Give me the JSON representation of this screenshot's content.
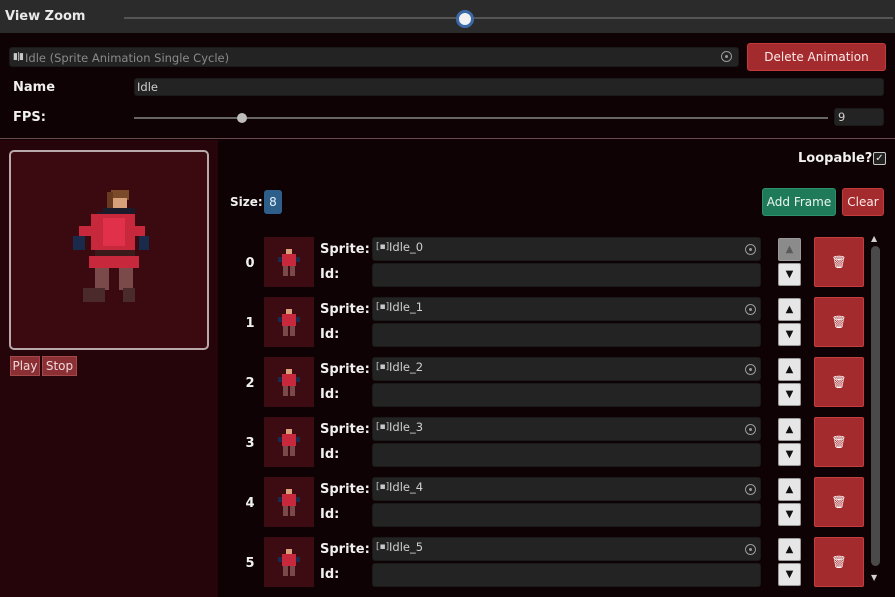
{
  "zoom": {
    "label": "View Zoom",
    "level": 0.43
  },
  "animation": {
    "asset_label": "Idle (Sprite Animation Single Cycle)",
    "delete_label": "Delete Animation",
    "name_label": "Name",
    "name_value": "Idle",
    "fps_label": "FPS:",
    "fps_value": "9",
    "fps_level": 0.15
  },
  "preview": {
    "play_label": "Play",
    "stop_label": "Stop"
  },
  "frames_panel": {
    "loopable_label": "Loopable?",
    "loopable_checked": "✓",
    "size_label": "Size:",
    "size_value": "8",
    "add_frame_label": "Add Frame",
    "clear_label": "Clear",
    "sprite_label": "Sprite:",
    "id_label": "Id:",
    "frames": [
      {
        "index": "0",
        "sprite": "Idle_0",
        "id": ""
      },
      {
        "index": "1",
        "sprite": "Idle_1",
        "id": ""
      },
      {
        "index": "2",
        "sprite": "Idle_2",
        "id": ""
      },
      {
        "index": "3",
        "sprite": "Idle_3",
        "id": ""
      },
      {
        "index": "4",
        "sprite": "Idle_4",
        "id": ""
      },
      {
        "index": "5",
        "sprite": "Idle_5",
        "id": ""
      }
    ]
  },
  "colors": {
    "accent_red": "#a32a2d",
    "accent_green": "#1f7a5a",
    "accent_blue": "#2d5f8a",
    "background": "#0f0204"
  },
  "icons": [
    "target-icon",
    "sprite-icon",
    "arrow-up-icon",
    "arrow-down-icon",
    "trash-icon",
    "check-icon",
    "character-sprite-icon"
  ]
}
